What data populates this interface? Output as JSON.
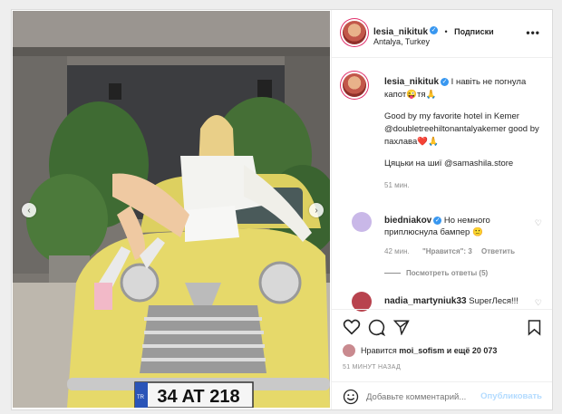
{
  "post": {
    "username": "lesia_nikituk",
    "location": "Antalya, Turkey",
    "follow_label": "Подписки",
    "more_label": "•••",
    "plate_text": "34 AT 218",
    "plate_country": "TR"
  },
  "caption": {
    "username": "lesia_nikituk",
    "line1": "І навіть не погнула капот😜тя🙏",
    "line2": "Good by my favorite hotel in Kemer @doubletreehiltonantalyakemer good by пахлава❤️🙏",
    "line3": "Цяцьки на шиї @samashila.store",
    "time": "51 мин."
  },
  "comments": [
    {
      "username": "biedniakov",
      "text": "Но немного приплюснула бампер 🙂",
      "time": "42 мин.",
      "likes": "\"Нравится\": 3",
      "reply": "Ответить",
      "view_replies": "Посмотреть ответы (5)"
    },
    {
      "username": "nadia_martyniuk33",
      "text": "SuperЛеся!!!"
    }
  ],
  "likes": {
    "prefix": "Нравится",
    "user": "moi_sofism",
    "suffix": "и ещё 20 073"
  },
  "timestamp": "51 МИНУТ НАЗАД",
  "add_comment": {
    "placeholder": "Добавьте комментарий...",
    "publish": "Опубликовать"
  },
  "colors": {
    "accent": "#3897f0",
    "car": "#e6d96a",
    "heart": "#ed4956"
  }
}
